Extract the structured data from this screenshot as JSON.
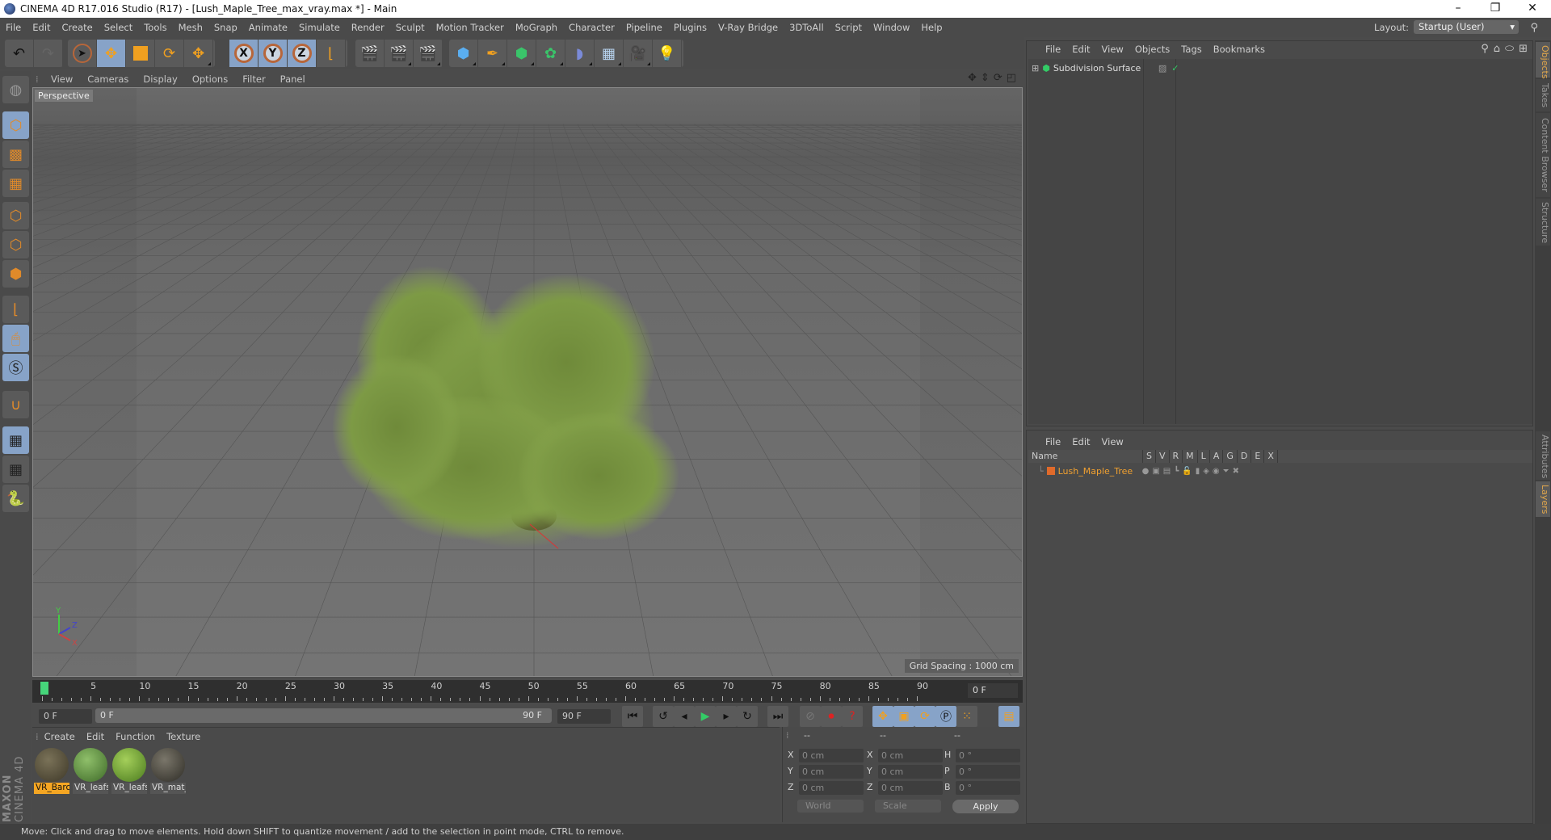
{
  "window": {
    "title": "CINEMA 4D R17.016 Studio (R17) - [Lush_Maple_Tree_max_vray.max *] - Main",
    "controls": [
      "minimize",
      "restore",
      "close"
    ]
  },
  "menubar": {
    "items": [
      "File",
      "Edit",
      "Create",
      "Select",
      "Tools",
      "Mesh",
      "Snap",
      "Animate",
      "Simulate",
      "Render",
      "Sculpt",
      "Motion Tracker",
      "MoGraph",
      "Character",
      "Pipeline",
      "Plugins",
      "V-Ray Bridge",
      "3DToAll",
      "Script",
      "Window",
      "Help"
    ],
    "layout_label": "Layout:",
    "layout_value": "Startup (User)"
  },
  "toolbar": {
    "groups": [
      [
        "undo-icon",
        "redo-icon"
      ],
      [
        "select-icon",
        "move-icon",
        "scale-icon",
        "rotate-icon",
        "move-last-icon"
      ],
      [
        "x-axis-lock",
        "y-axis-lock",
        "z-axis-lock",
        "coordinate-system-icon"
      ],
      [
        "render-view-icon",
        "render-picture-viewer-icon",
        "render-settings-icon"
      ],
      [
        "cube-icon",
        "pen-icon",
        "subdivision-icon",
        "cloner-icon",
        "deformer-icon",
        "floor-icon",
        "camera-icon",
        "light-icon"
      ]
    ],
    "axis_labels": [
      "X",
      "Y",
      "Z"
    ]
  },
  "left_toolbar": {
    "tools": [
      "make-editable",
      "model-mode",
      "texture-mode",
      "workplane-mode",
      "points-mode",
      "edges-mode",
      "polygons-mode",
      "axis-mode",
      "tweak-mode",
      "solo-mode",
      "snap",
      "locked-workplane",
      "planar-workplane",
      "python"
    ]
  },
  "viewport": {
    "menu": [
      "View",
      "Cameras",
      "Display",
      "Options",
      "Filter",
      "Panel"
    ],
    "camera_label": "Perspective",
    "grid_spacing": "Grid Spacing : 1000 cm",
    "axis_labels": [
      "Y",
      "Z",
      "X"
    ]
  },
  "timeline": {
    "ticks": [
      "0",
      "5",
      "10",
      "15",
      "20",
      "25",
      "30",
      "35",
      "40",
      "45",
      "50",
      "55",
      "60",
      "65",
      "70",
      "75",
      "80",
      "85",
      "90"
    ],
    "current_frame": "0 F",
    "start_field": "0 F",
    "range_start": "0 F",
    "range_end": "90 F",
    "end_field": "90 F"
  },
  "materials": {
    "menu": [
      "Create",
      "Edit",
      "Function",
      "Texture"
    ],
    "items": [
      {
        "name": "VR_Barc",
        "selected": true,
        "color": "#5c5540"
      },
      {
        "name": "VR_leafs",
        "selected": false,
        "color": "#5c8a3a"
      },
      {
        "name": "VR_leafs",
        "selected": false,
        "color": "#6e9a2c"
      },
      {
        "name": "VR_mat_",
        "selected": false,
        "color": "#4e4a40"
      }
    ],
    "brand_top": "CINEMA 4D",
    "brand_bottom": "MAXON"
  },
  "coordinates": {
    "headers": [
      "--",
      "--",
      "--"
    ],
    "rows": [
      {
        "l1": "X",
        "v1": "0 cm",
        "l2": "X",
        "v2": "0 cm",
        "l3": "H",
        "v3": "0 °"
      },
      {
        "l1": "Y",
        "v1": "0 cm",
        "l2": "Y",
        "v2": "0 cm",
        "l3": "P",
        "v3": "0 °"
      },
      {
        "l1": "Z",
        "v1": "0 cm",
        "l2": "Z",
        "v2": "0 cm",
        "l3": "B",
        "v3": "0 °"
      }
    ],
    "mode": "World",
    "type": "Scale",
    "apply_label": "Apply"
  },
  "object_manager": {
    "menu": [
      "File",
      "Edit",
      "View",
      "Objects",
      "Tags",
      "Bookmarks"
    ],
    "objects": [
      {
        "name": "Subdivision Surface",
        "enabled": true
      }
    ]
  },
  "layer_manager": {
    "menu": [
      "File",
      "Edit",
      "View"
    ],
    "columns": [
      "Name",
      "S",
      "V",
      "R",
      "M",
      "L",
      "A",
      "G",
      "D",
      "E",
      "X"
    ],
    "layers": [
      {
        "name": "Lush_Maple_Tree",
        "color": "#e06a2a"
      }
    ]
  },
  "side_tabs": {
    "top": [
      {
        "label": "Objects",
        "active": true
      },
      {
        "label": "Takes",
        "active": false
      },
      {
        "label": "Content Browser",
        "active": false
      },
      {
        "label": "Structure",
        "active": false
      }
    ],
    "bottom": [
      {
        "label": "Attributes",
        "active": false
      },
      {
        "label": "Layers",
        "active": true
      }
    ]
  },
  "status": {
    "text": "Move: Click and drag to move elements. Hold down SHIFT to quantize movement / add to the selection in point mode, CTRL to remove."
  }
}
